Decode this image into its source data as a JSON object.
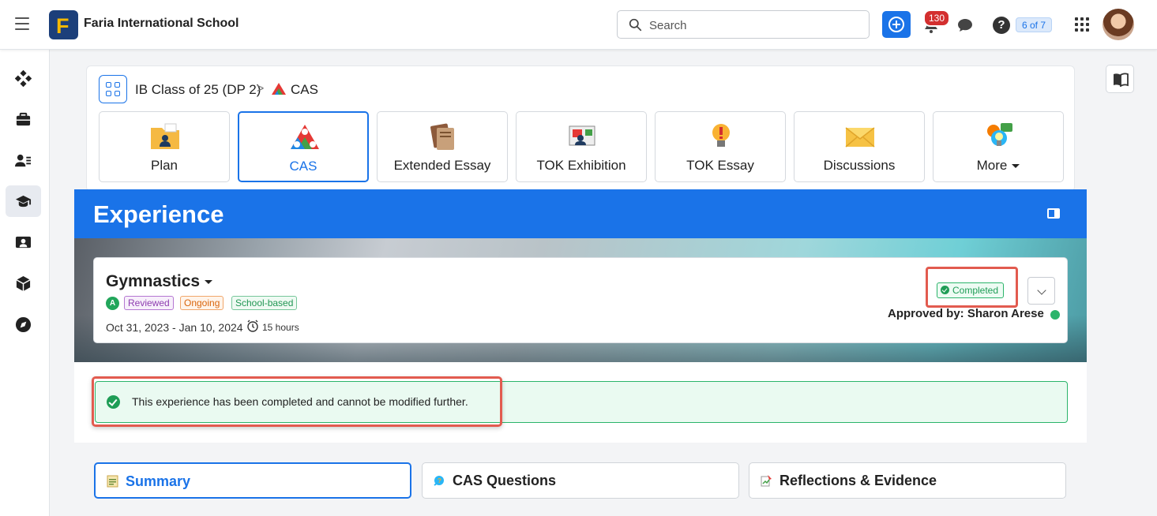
{
  "topbar": {
    "school_name": "Faria International School",
    "logo_letter": "F",
    "search_placeholder": "Search",
    "notification_count": "130",
    "help_icon": "?",
    "pager": "6 of 7"
  },
  "breadcrumb": {
    "class_name": "IB Class of 25 (DP 2)",
    "separator": ">",
    "current": "CAS"
  },
  "tiles": [
    {
      "label": "Plan",
      "icon": "plan-folder-icon"
    },
    {
      "label": "CAS",
      "icon": "cas-triangle-icon"
    },
    {
      "label": "Extended Essay",
      "icon": "extended-essay-icon"
    },
    {
      "label": "TOK Exhibition",
      "icon": "tok-exhibition-icon"
    },
    {
      "label": "TOK Essay",
      "icon": "tok-essay-icon"
    },
    {
      "label": "Discussions",
      "icon": "envelope-icon"
    },
    {
      "label": "More",
      "icon": "more-icon"
    }
  ],
  "experience": {
    "header_title": "Experience",
    "name": "Gymnastics",
    "strand_badge": "A",
    "tags": [
      "Reviewed",
      "Ongoing",
      "School-based"
    ],
    "dates": "Oct 31, 2023 - Jan 10, 2024",
    "hours": "15 hours",
    "status": "Completed",
    "approved_by": "Approved by: Sharon Arese"
  },
  "alert": {
    "message": "This experience has been completed and cannot be modified further."
  },
  "sub_tabs": [
    {
      "label": "Summary"
    },
    {
      "label": "CAS Questions"
    },
    {
      "label": "Reflections & Evidence"
    }
  ],
  "colors": {
    "primary": "#1a73e8",
    "success": "#1f9d56",
    "highlight": "#e25b4f",
    "notification": "#d32f2f"
  }
}
